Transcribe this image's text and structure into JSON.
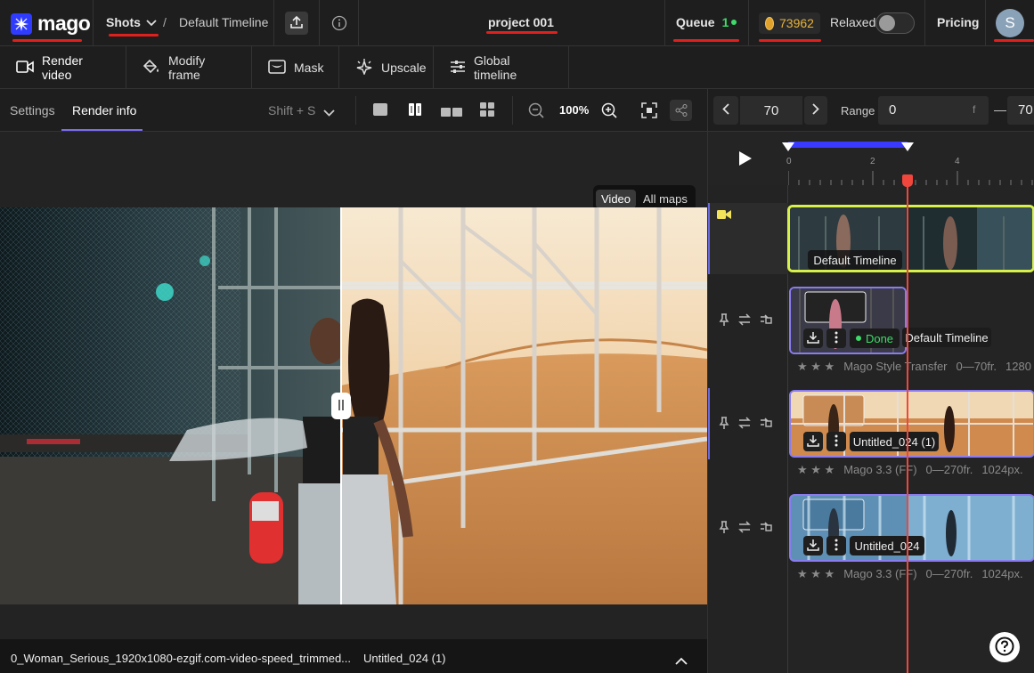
{
  "header": {
    "logo_text": "mago",
    "shots_label": "Shots",
    "breadcrumb_sep": "/",
    "breadcrumb_current": "Default Timeline",
    "project_title": "project 001",
    "queue_label": "Queue",
    "queue_count": "1",
    "credits": "73962",
    "relaxed_label": "Relaxed",
    "pricing_label": "Pricing",
    "avatar_initial": "S"
  },
  "toolbar": {
    "items": [
      {
        "label": "Render video",
        "icon": "video-camera-icon"
      },
      {
        "label": "Modify frame",
        "icon": "paint-bucket-icon"
      },
      {
        "label": "Mask",
        "icon": "mask-icon"
      },
      {
        "label": "Upscale",
        "icon": "sparkle-icon"
      },
      {
        "label": "Global timeline",
        "icon": "sliders-icon"
      }
    ]
  },
  "subbar": {
    "tabs": [
      "Settings",
      "Render info"
    ],
    "active_tab": "Render info",
    "shortcut": "Shift + S",
    "zoom": "100%"
  },
  "viewer": {
    "toggle": [
      "Video",
      "All maps"
    ],
    "active_toggle": "Video",
    "left_file": "0_Woman_Serious_1920x1080-ezgif.com-video-speed_trimmed...",
    "right_file": "Untitled_024 (1)"
  },
  "timeline": {
    "frame": "70",
    "range_label": "Range",
    "range_start": "0",
    "range_unit": "f",
    "range_dash": "—",
    "range_end": "70",
    "ruler_labels": [
      "0",
      "2",
      "4"
    ],
    "tracks": [
      {
        "label": "Default Timeline"
      },
      {
        "status": "Done",
        "label": "Default Timeline",
        "stars": "★ ★ ★",
        "model": "Mago Style Transfer",
        "frames": "0—70fr.",
        "size": "1280"
      },
      {
        "label": "Untitled_024 (1)",
        "stars": "★ ★ ★",
        "model": "Mago 3.3 (FF)",
        "frames": "0—270fr.",
        "size": "1024px."
      },
      {
        "label": "Untitled_024",
        "stars": "★ ★ ★",
        "model": "Mago 3.3 (FF)",
        "frames": "0—270fr.",
        "size": "1024px."
      }
    ]
  },
  "colors": {
    "accent_blue": "#3a3aff",
    "playhead_red": "#f0463c",
    "done_green": "#3ddc6a",
    "selected_yellow": "#d7f04a",
    "purple_outline": "#8a7cf0"
  }
}
